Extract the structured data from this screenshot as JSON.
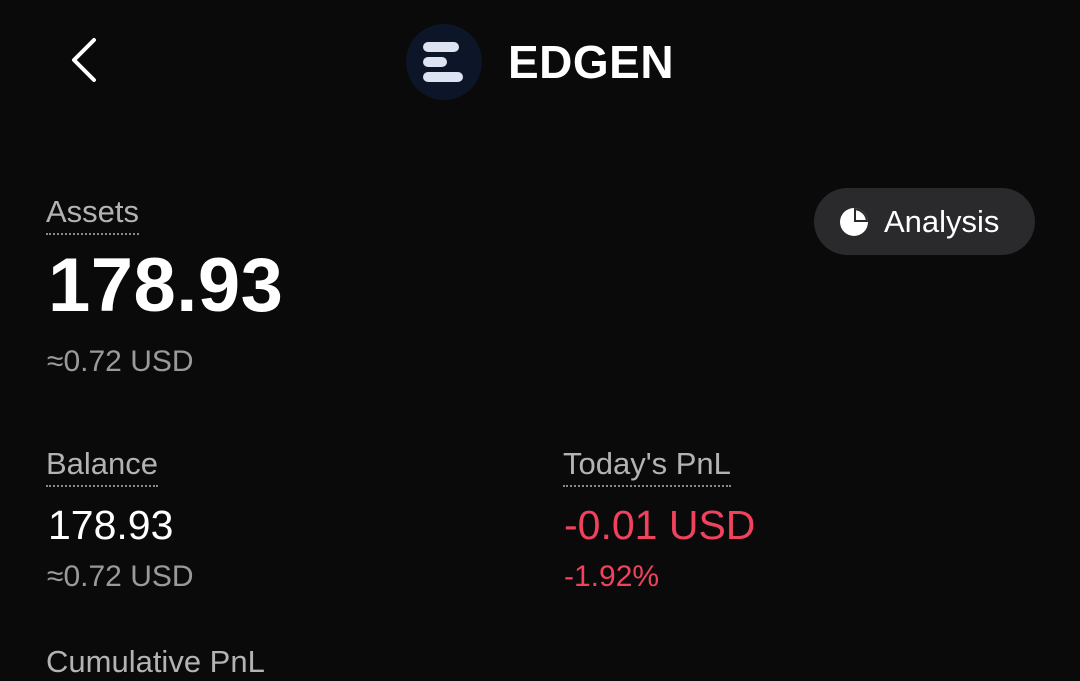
{
  "header": {
    "token_name": "EDGEN",
    "back_icon": "chevron-left-icon",
    "logo_icon": "edgen-logo-icon"
  },
  "assets": {
    "label": "Assets",
    "value": "178.93",
    "usd": "≈0.72 USD"
  },
  "analysis_button": {
    "label": "Analysis",
    "icon": "pie-chart-icon"
  },
  "balance": {
    "label": "Balance",
    "value": "178.93",
    "usd": "≈0.72 USD"
  },
  "todays_pnl": {
    "label": "Today's PnL",
    "value": "-0.01 USD",
    "percent": "-1.92%"
  },
  "next_section": {
    "label": "Cumulative PnL"
  },
  "colors": {
    "background": "#0a0a0a",
    "negative": "#f0415d",
    "secondary_text": "#9a9a9a",
    "button_bg": "#2a2a2c"
  }
}
